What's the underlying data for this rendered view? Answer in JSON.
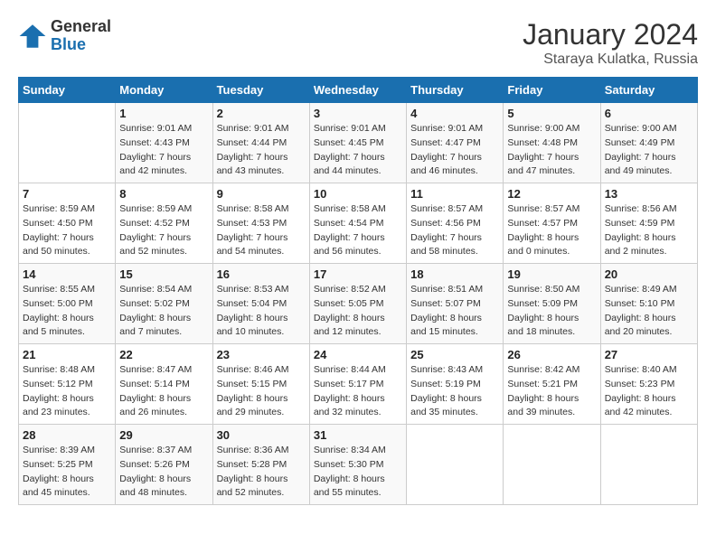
{
  "logo": {
    "line1": "General",
    "line2": "Blue"
  },
  "title": "January 2024",
  "subtitle": "Staraya Kulatka, Russia",
  "days_of_week": [
    "Sunday",
    "Monday",
    "Tuesday",
    "Wednesday",
    "Thursday",
    "Friday",
    "Saturday"
  ],
  "weeks": [
    [
      {
        "day": "",
        "sunrise": "",
        "sunset": "",
        "daylight": ""
      },
      {
        "day": "1",
        "sunrise": "Sunrise: 9:01 AM",
        "sunset": "Sunset: 4:43 PM",
        "daylight": "Daylight: 7 hours and 42 minutes."
      },
      {
        "day": "2",
        "sunrise": "Sunrise: 9:01 AM",
        "sunset": "Sunset: 4:44 PM",
        "daylight": "Daylight: 7 hours and 43 minutes."
      },
      {
        "day": "3",
        "sunrise": "Sunrise: 9:01 AM",
        "sunset": "Sunset: 4:45 PM",
        "daylight": "Daylight: 7 hours and 44 minutes."
      },
      {
        "day": "4",
        "sunrise": "Sunrise: 9:01 AM",
        "sunset": "Sunset: 4:47 PM",
        "daylight": "Daylight: 7 hours and 46 minutes."
      },
      {
        "day": "5",
        "sunrise": "Sunrise: 9:00 AM",
        "sunset": "Sunset: 4:48 PM",
        "daylight": "Daylight: 7 hours and 47 minutes."
      },
      {
        "day": "6",
        "sunrise": "Sunrise: 9:00 AM",
        "sunset": "Sunset: 4:49 PM",
        "daylight": "Daylight: 7 hours and 49 minutes."
      }
    ],
    [
      {
        "day": "7",
        "sunrise": "Sunrise: 8:59 AM",
        "sunset": "Sunset: 4:50 PM",
        "daylight": "Daylight: 7 hours and 50 minutes."
      },
      {
        "day": "8",
        "sunrise": "Sunrise: 8:59 AM",
        "sunset": "Sunset: 4:52 PM",
        "daylight": "Daylight: 7 hours and 52 minutes."
      },
      {
        "day": "9",
        "sunrise": "Sunrise: 8:58 AM",
        "sunset": "Sunset: 4:53 PM",
        "daylight": "Daylight: 7 hours and 54 minutes."
      },
      {
        "day": "10",
        "sunrise": "Sunrise: 8:58 AM",
        "sunset": "Sunset: 4:54 PM",
        "daylight": "Daylight: 7 hours and 56 minutes."
      },
      {
        "day": "11",
        "sunrise": "Sunrise: 8:57 AM",
        "sunset": "Sunset: 4:56 PM",
        "daylight": "Daylight: 7 hours and 58 minutes."
      },
      {
        "day": "12",
        "sunrise": "Sunrise: 8:57 AM",
        "sunset": "Sunset: 4:57 PM",
        "daylight": "Daylight: 8 hours and 0 minutes."
      },
      {
        "day": "13",
        "sunrise": "Sunrise: 8:56 AM",
        "sunset": "Sunset: 4:59 PM",
        "daylight": "Daylight: 8 hours and 2 minutes."
      }
    ],
    [
      {
        "day": "14",
        "sunrise": "Sunrise: 8:55 AM",
        "sunset": "Sunset: 5:00 PM",
        "daylight": "Daylight: 8 hours and 5 minutes."
      },
      {
        "day": "15",
        "sunrise": "Sunrise: 8:54 AM",
        "sunset": "Sunset: 5:02 PM",
        "daylight": "Daylight: 8 hours and 7 minutes."
      },
      {
        "day": "16",
        "sunrise": "Sunrise: 8:53 AM",
        "sunset": "Sunset: 5:04 PM",
        "daylight": "Daylight: 8 hours and 10 minutes."
      },
      {
        "day": "17",
        "sunrise": "Sunrise: 8:52 AM",
        "sunset": "Sunset: 5:05 PM",
        "daylight": "Daylight: 8 hours and 12 minutes."
      },
      {
        "day": "18",
        "sunrise": "Sunrise: 8:51 AM",
        "sunset": "Sunset: 5:07 PM",
        "daylight": "Daylight: 8 hours and 15 minutes."
      },
      {
        "day": "19",
        "sunrise": "Sunrise: 8:50 AM",
        "sunset": "Sunset: 5:09 PM",
        "daylight": "Daylight: 8 hours and 18 minutes."
      },
      {
        "day": "20",
        "sunrise": "Sunrise: 8:49 AM",
        "sunset": "Sunset: 5:10 PM",
        "daylight": "Daylight: 8 hours and 20 minutes."
      }
    ],
    [
      {
        "day": "21",
        "sunrise": "Sunrise: 8:48 AM",
        "sunset": "Sunset: 5:12 PM",
        "daylight": "Daylight: 8 hours and 23 minutes."
      },
      {
        "day": "22",
        "sunrise": "Sunrise: 8:47 AM",
        "sunset": "Sunset: 5:14 PM",
        "daylight": "Daylight: 8 hours and 26 minutes."
      },
      {
        "day": "23",
        "sunrise": "Sunrise: 8:46 AM",
        "sunset": "Sunset: 5:15 PM",
        "daylight": "Daylight: 8 hours and 29 minutes."
      },
      {
        "day": "24",
        "sunrise": "Sunrise: 8:44 AM",
        "sunset": "Sunset: 5:17 PM",
        "daylight": "Daylight: 8 hours and 32 minutes."
      },
      {
        "day": "25",
        "sunrise": "Sunrise: 8:43 AM",
        "sunset": "Sunset: 5:19 PM",
        "daylight": "Daylight: 8 hours and 35 minutes."
      },
      {
        "day": "26",
        "sunrise": "Sunrise: 8:42 AM",
        "sunset": "Sunset: 5:21 PM",
        "daylight": "Daylight: 8 hours and 39 minutes."
      },
      {
        "day": "27",
        "sunrise": "Sunrise: 8:40 AM",
        "sunset": "Sunset: 5:23 PM",
        "daylight": "Daylight: 8 hours and 42 minutes."
      }
    ],
    [
      {
        "day": "28",
        "sunrise": "Sunrise: 8:39 AM",
        "sunset": "Sunset: 5:25 PM",
        "daylight": "Daylight: 8 hours and 45 minutes."
      },
      {
        "day": "29",
        "sunrise": "Sunrise: 8:37 AM",
        "sunset": "Sunset: 5:26 PM",
        "daylight": "Daylight: 8 hours and 48 minutes."
      },
      {
        "day": "30",
        "sunrise": "Sunrise: 8:36 AM",
        "sunset": "Sunset: 5:28 PM",
        "daylight": "Daylight: 8 hours and 52 minutes."
      },
      {
        "day": "31",
        "sunrise": "Sunrise: 8:34 AM",
        "sunset": "Sunset: 5:30 PM",
        "daylight": "Daylight: 8 hours and 55 minutes."
      },
      {
        "day": "",
        "sunrise": "",
        "sunset": "",
        "daylight": ""
      },
      {
        "day": "",
        "sunrise": "",
        "sunset": "",
        "daylight": ""
      },
      {
        "day": "",
        "sunrise": "",
        "sunset": "",
        "daylight": ""
      }
    ]
  ]
}
